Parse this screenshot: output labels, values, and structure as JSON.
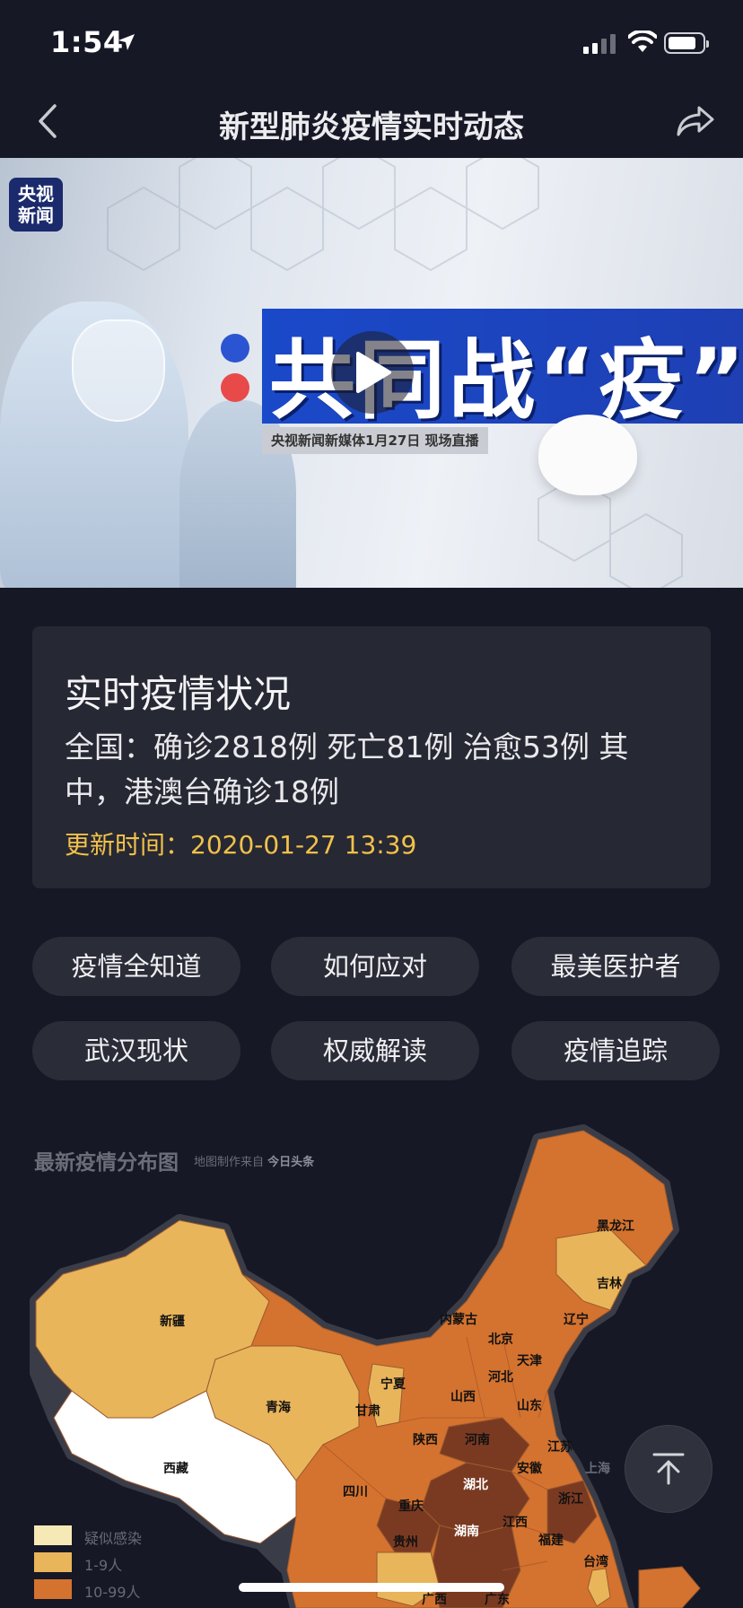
{
  "status_bar": {
    "time": "1:54",
    "battery_level": 0.82
  },
  "nav": {
    "title": "新型肺炎疫情实时动态"
  },
  "video": {
    "logo_line1": "央视",
    "logo_line2": "新闻",
    "headline": "共同战“疫”",
    "subtitle": "央视新闻新媒体1月27日 现场直播"
  },
  "info_card": {
    "title": "实时疫情状况",
    "stats": "全国：确诊2818例 死亡81例 治愈53例 其中，港澳台确诊18例",
    "update": "更新时间：2020-01-27 13:39"
  },
  "tags": [
    {
      "label": "疫情全知道"
    },
    {
      "label": "如何应对"
    },
    {
      "label": "最美医护者"
    },
    {
      "label": "武汉现状"
    },
    {
      "label": "权威解读"
    },
    {
      "label": "疫情追踪"
    }
  ],
  "map": {
    "title": "最新疫情分布图",
    "credit_prefix": "地图制作来自",
    "credit_source": "今日头条",
    "colors": {
      "suspect": "#f7e9b6",
      "level1": "#e9b55a",
      "level2": "#d4732f",
      "level3": "#7a3a22",
      "none": "#ffffff"
    },
    "provinces": {
      "heilongjiang": "黑龙江",
      "jilin": "吉林",
      "liaoning": "辽宁",
      "neimenggu": "内蒙古",
      "beijing": "北京",
      "tianjin": "天津",
      "hebei": "河北",
      "shanxi": "山西",
      "shandong": "山东",
      "xinjiang": "新疆",
      "qinghai": "青海",
      "gansu": "甘肃",
      "ningxia": "宁夏",
      "shaanxi": "陕西",
      "henan": "河南",
      "jiangsu": "江苏",
      "anhui": "安徽",
      "shanghai": "上海",
      "hubei": "湖北",
      "xizang": "西藏",
      "sichuan": "四川",
      "chongqing": "重庆",
      "zhejiang": "浙江",
      "guizhou": "贵州",
      "hunan": "湖南",
      "jiangxi": "江西",
      "fujian": "福建",
      "guangxi": "广西",
      "guangdong": "广东",
      "taiwan": "台湾"
    },
    "legend": [
      {
        "label": "疑似感染"
      },
      {
        "label": "1-9人"
      },
      {
        "label": "10-99人"
      }
    ]
  }
}
